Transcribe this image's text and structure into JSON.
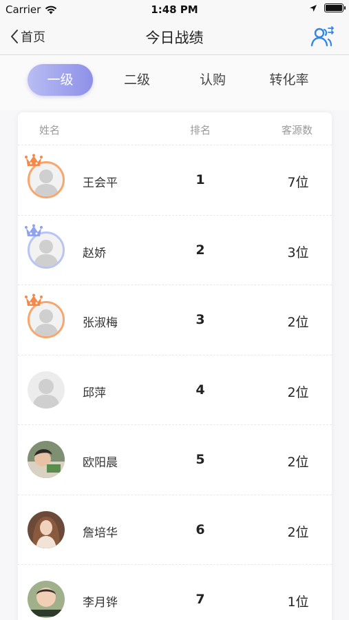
{
  "status_bar": {
    "carrier": "Carrier",
    "time": "1:48 PM"
  },
  "nav": {
    "back_label": "首页",
    "title": "今日战绩",
    "action_icon": "users-switch-icon"
  },
  "tabs": [
    {
      "label": "一级",
      "active": true
    },
    {
      "label": "二级",
      "active": false
    },
    {
      "label": "认购",
      "active": false
    },
    {
      "label": "转化率",
      "active": false
    }
  ],
  "table": {
    "headers": {
      "name": "姓名",
      "rank": "排名",
      "count": "客源数"
    },
    "rows": [
      {
        "name": "王会平",
        "rank": "1",
        "count": "7位",
        "avatar": "placeholder",
        "crown": "orange"
      },
      {
        "name": "赵娇",
        "rank": "2",
        "count": "3位",
        "avatar": "placeholder",
        "crown": "blue"
      },
      {
        "name": "张淑梅",
        "rank": "3",
        "count": "2位",
        "avatar": "placeholder",
        "crown": "orange"
      },
      {
        "name": "邱萍",
        "rank": "4",
        "count": "2位",
        "avatar": "placeholder",
        "crown": "none"
      },
      {
        "name": "欧阳晨",
        "rank": "5",
        "count": "2位",
        "avatar": "photo",
        "crown": "none"
      },
      {
        "name": "詹培华",
        "rank": "6",
        "count": "2位",
        "avatar": "photo",
        "crown": "none"
      },
      {
        "name": "李月铧",
        "rank": "7",
        "count": "1位",
        "avatar": "photo",
        "crown": "none"
      }
    ]
  },
  "colors": {
    "accent": "#3b82f6",
    "tab_gradient_start": "#b8bdf3",
    "tab_gradient_end": "#8e90e8",
    "crown_orange": "#f5894a",
    "crown_blue": "#8fa2f0"
  }
}
